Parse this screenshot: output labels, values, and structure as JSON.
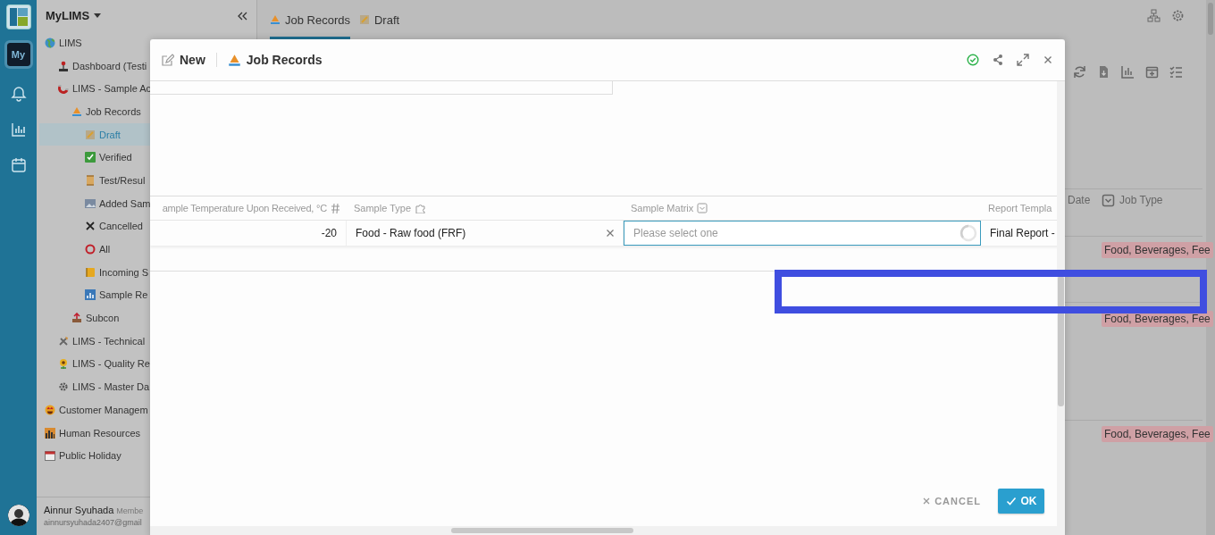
{
  "rail": {
    "badge": "My"
  },
  "sidebar": {
    "title": "MyLIMS",
    "items": [
      {
        "label": "LIMS",
        "selected": false,
        "children": [
          {
            "label": "Dashboard (Testi",
            "selected": false
          },
          {
            "label": "LIMS - Sample Ac",
            "selected": false,
            "children": [
              {
                "label": "Job Records",
                "selected": false,
                "children": [
                  {
                    "label": "Draft",
                    "selected": true
                  },
                  {
                    "label": "Verified",
                    "selected": false
                  },
                  {
                    "label": "Test/Resul",
                    "selected": false
                  },
                  {
                    "label": "Added Sam",
                    "selected": false
                  },
                  {
                    "label": "Cancelled",
                    "selected": false
                  },
                  {
                    "label": "All",
                    "selected": false
                  },
                  {
                    "label": "Incoming S",
                    "selected": false
                  },
                  {
                    "label": "Sample Re",
                    "selected": false
                  }
                ]
              },
              {
                "label": "Subcon",
                "selected": false
              }
            ]
          },
          {
            "label": "LIMS - Technical",
            "selected": false
          },
          {
            "label": "LIMS - Quality Re",
            "selected": false
          },
          {
            "label": "LIMS - Master Da",
            "selected": false
          }
        ]
      },
      {
        "label": "Customer Managem",
        "selected": false
      },
      {
        "label": "Human Resources",
        "selected": false
      },
      {
        "label": "Public Holiday",
        "selected": false
      }
    ]
  },
  "user": {
    "name": "Ainnur Syuhada",
    "role": "Membe",
    "email": "ainnursyuhada2407@gmail"
  },
  "main": {
    "tabs": [
      {
        "label": "Job Records",
        "selected": true
      },
      {
        "label": "Draft",
        "selected": false
      }
    ],
    "table": {
      "columns": [
        "Date",
        "Job Type"
      ],
      "rows": [
        {
          "job_type": "Food, Beverages, Fee"
        },
        {
          "job_type": "Food, Beverages, Fee"
        },
        {
          "job_type": "Food, Beverages, Fee"
        }
      ]
    }
  },
  "dialog": {
    "mode": "New",
    "title": "Job Records",
    "columns": [
      "ample Temperature Upon Received, °C",
      "Sample Type",
      "Sample Matrix",
      "Report Templa"
    ],
    "cells": [
      {
        "kind": "number",
        "value": "-20"
      },
      {
        "kind": "select",
        "value": "Food - Raw food (FRF)"
      },
      {
        "kind": "input",
        "placeholder": "Please select one"
      },
      {
        "kind": "text",
        "value": "Final Report -"
      }
    ],
    "cancel": "CANCEL",
    "ok": "OK"
  }
}
